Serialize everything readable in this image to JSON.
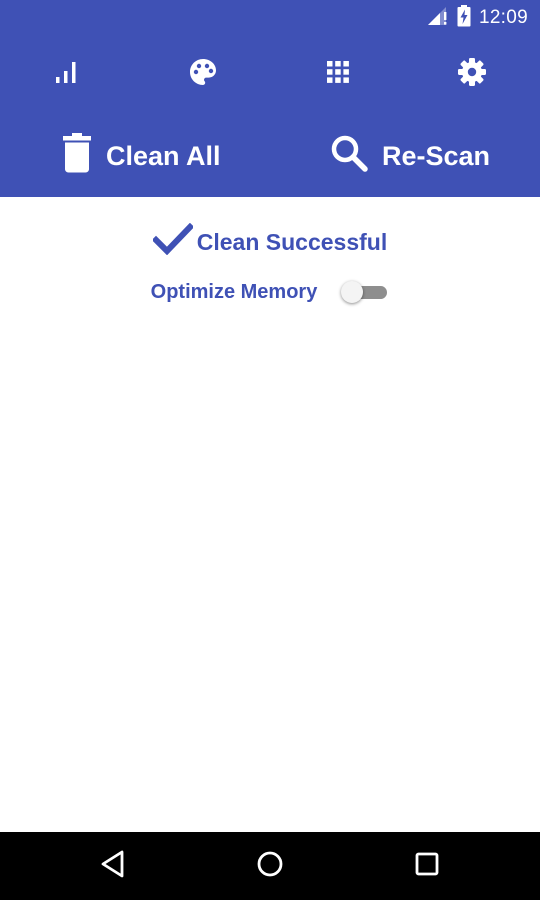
{
  "status_bar": {
    "time": "12:09",
    "icons": [
      "cell-signal-icon",
      "battery-charging-icon"
    ]
  },
  "toolbar": {
    "icons": [
      "stats-icon",
      "palette-icon",
      "apps-grid-icon",
      "settings-icon"
    ]
  },
  "actions": {
    "clean_all_label": "Clean All",
    "rescan_label": "Re-Scan",
    "clean_all_icon": "trash-icon",
    "rescan_icon": "search-icon"
  },
  "main": {
    "result_text": "Clean Successful",
    "result_icon": "checkmark-icon",
    "option_label": "Optimize Memory",
    "option_enabled": false
  },
  "nav_bar": {
    "icons": [
      "back-icon",
      "home-icon",
      "recents-icon"
    ]
  },
  "colors": {
    "primary": "#3f51b5",
    "background": "#ffffff",
    "nav_background": "#000000"
  }
}
